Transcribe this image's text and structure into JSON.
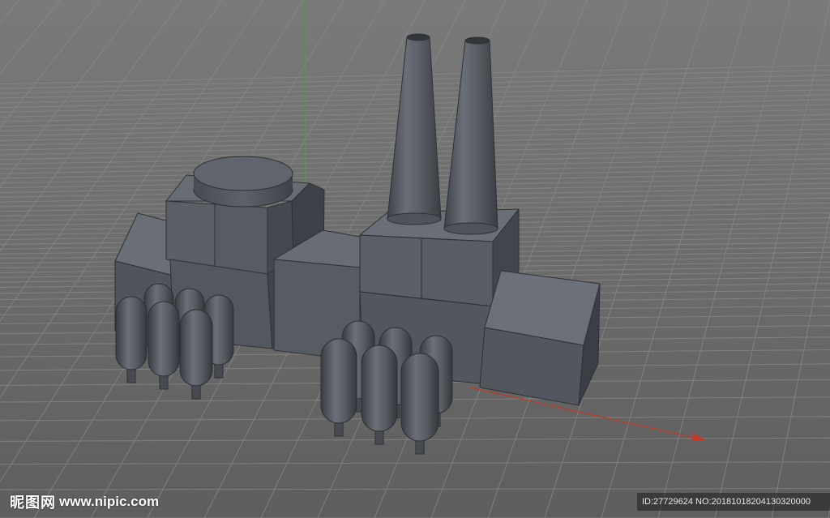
{
  "viewport": {
    "background": "#6e6e6e",
    "grid_color": "#8a8a8a",
    "y_axis_color": "#3fa34d",
    "x_axis_color": "#c0392b"
  },
  "scene": {
    "model": "factory",
    "material_color": "#5b5f66"
  },
  "watermark": {
    "brand_cn": "昵图网",
    "brand_url": "www.nipic.com",
    "id_text": "ID:27729624 NO:20181018204130320000"
  }
}
